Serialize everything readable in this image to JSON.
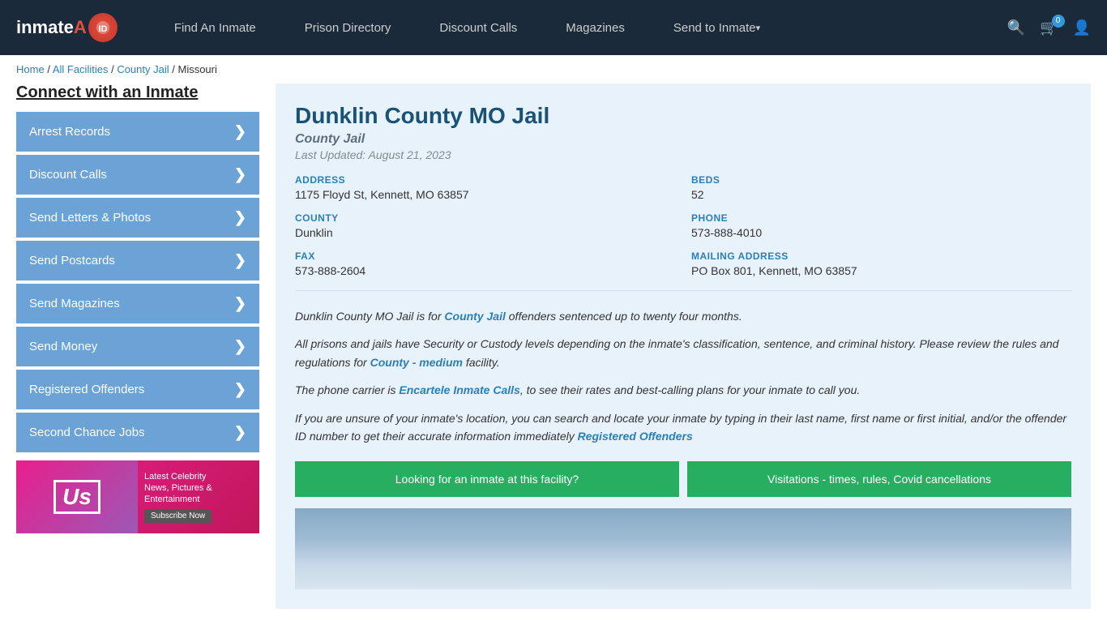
{
  "header": {
    "logo": "inmateAID",
    "nav_items": [
      {
        "label": "Find An Inmate",
        "has_arrow": false
      },
      {
        "label": "Prison Directory",
        "has_arrow": false
      },
      {
        "label": "Discount Calls",
        "has_arrow": false
      },
      {
        "label": "Magazines",
        "has_arrow": false
      },
      {
        "label": "Send to Inmate",
        "has_arrow": true
      }
    ],
    "cart_count": "0"
  },
  "breadcrumb": {
    "items": [
      "Home",
      "All Facilities",
      "County Jail",
      "Missouri"
    ]
  },
  "sidebar": {
    "title": "Connect with an Inmate",
    "items": [
      {
        "label": "Arrest Records"
      },
      {
        "label": "Discount Calls"
      },
      {
        "label": "Send Letters & Photos"
      },
      {
        "label": "Send Postcards"
      },
      {
        "label": "Send Magazines"
      },
      {
        "label": "Send Money"
      },
      {
        "label": "Registered Offenders"
      },
      {
        "label": "Second Chance Jobs"
      }
    ]
  },
  "ad": {
    "logo": "Us",
    "line1": "Latest Celebrity",
    "line2": "News, Pictures &",
    "line3": "Entertainment",
    "button": "Subscribe Now"
  },
  "facility": {
    "title": "Dunklin County MO Jail",
    "type": "County Jail",
    "updated": "Last Updated: August 21, 2023",
    "address_label": "ADDRESS",
    "address_value": "1175 Floyd St, Kennett, MO 63857",
    "beds_label": "BEDS",
    "beds_value": "52",
    "county_label": "COUNTY",
    "county_value": "Dunklin",
    "phone_label": "PHONE",
    "phone_value": "573-888-4010",
    "fax_label": "FAX",
    "fax_value": "573-888-2604",
    "mailing_label": "MAILING ADDRESS",
    "mailing_value": "PO Box 801, Kennett, MO 63857"
  },
  "description": {
    "para1_prefix": "Dunklin County MO Jail is for ",
    "para1_link": "County Jail",
    "para1_suffix": " offenders sentenced up to twenty four months.",
    "para2_prefix": "All prisons and jails have Security or Custody levels depending on the inmate's classification, sentence, and criminal history. Please review the rules and regulations for ",
    "para2_link": "County - medium",
    "para2_suffix": " facility.",
    "para3_prefix": "The phone carrier is ",
    "para3_link": "Encartele Inmate Calls",
    "para3_suffix": ", to see their rates and best-calling plans for your inmate to call you.",
    "para4_prefix": "If you are unsure of your inmate's location, you can search and locate your inmate by typing in their last name, first name or first initial, and/or the offender ID number to get their accurate information immediately ",
    "para4_link": "Registered Offenders"
  },
  "buttons": {
    "find_inmate": "Looking for an inmate at this facility?",
    "visitations": "Visitations - times, rules, Covid cancellations"
  }
}
